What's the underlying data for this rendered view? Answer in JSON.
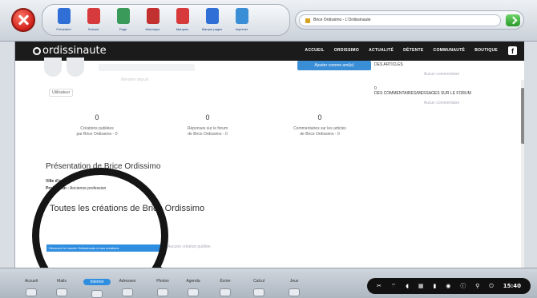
{
  "toolbar": {
    "tools": [
      {
        "label": "Précédent",
        "icon": "back-arrow-icon",
        "color": "#2f6fd6"
      },
      {
        "label": "Suivant",
        "icon": "forward-arrow-icon",
        "color": "#d63a3a"
      },
      {
        "label": "Page",
        "icon": "page-icon",
        "color": "#3a9a5a"
      },
      {
        "label": "Historique",
        "icon": "history-icon",
        "color": "#c23030"
      },
      {
        "label": "Marques",
        "icon": "bookmark-icon",
        "color": "#d63a3a"
      },
      {
        "label": "Marque pages",
        "icon": "bookmarks-icon",
        "color": "#2f6fd6"
      },
      {
        "label": "Imprimer",
        "icon": "printer-icon",
        "color": "#3a8ed6"
      }
    ],
    "url": "Brice Ordissimo - L'Ordissinaute"
  },
  "site": {
    "logo": "ordissinaute",
    "nav": [
      "ACCUEIL",
      "ORDISSIMO",
      "ACTUALITÉ",
      "DÉTENTE",
      "COMMUNAUTÉ",
      "BOUTIQUE"
    ],
    "fb": "f"
  },
  "profile": {
    "member_since": "Membre depuis",
    "role": "Utilisateur",
    "add_friend": "Ajouter comme ami(e)",
    "stats": [
      {
        "num": "0",
        "label1": "Créations publiées",
        "label2": "par Brice Ordissimo - 0"
      },
      {
        "num": "0",
        "label1": "Réponses sur le forum",
        "label2": "de Brice Ordissimo - 0"
      },
      {
        "num": "0",
        "label1": "Commentaires sur les articles",
        "label2": "de Brice Ordissimo - 0"
      }
    ],
    "presentation_title": "Présentation de Brice Ordissimo",
    "origin_label": "Ville d'origine :",
    "profession_label": "Profession :",
    "profession_value": "Ancienne profession",
    "creations_title": "Toutes les créations de Brice Ordissimo",
    "empty_creations": "Aucune création publiée",
    "banner": "Découvrir le monde Ordissinaute et ses créations"
  },
  "sidebar": {
    "articles_title": "DES ARTICLES",
    "articles_empty": "Aucun commentaire",
    "forum_count": "0",
    "forum_title": "DES COMMENTAIRES/MESSAGES SUR LE FORUM",
    "forum_empty": "Aucun commentaire"
  },
  "dock": {
    "items": [
      "Accueil",
      "Mails",
      "Internet",
      "Adresses",
      "Photos",
      "Agenda",
      "Écrire",
      "Calcul",
      "Jeux"
    ],
    "active_index": 2,
    "status_icons": [
      "tools-icon",
      "wifi-icon",
      "volume-icon",
      "keyboard-icon",
      "battery-icon",
      "sync-icon",
      "info-icon",
      "usb-icon",
      "power-icon"
    ],
    "time": "15:40"
  }
}
